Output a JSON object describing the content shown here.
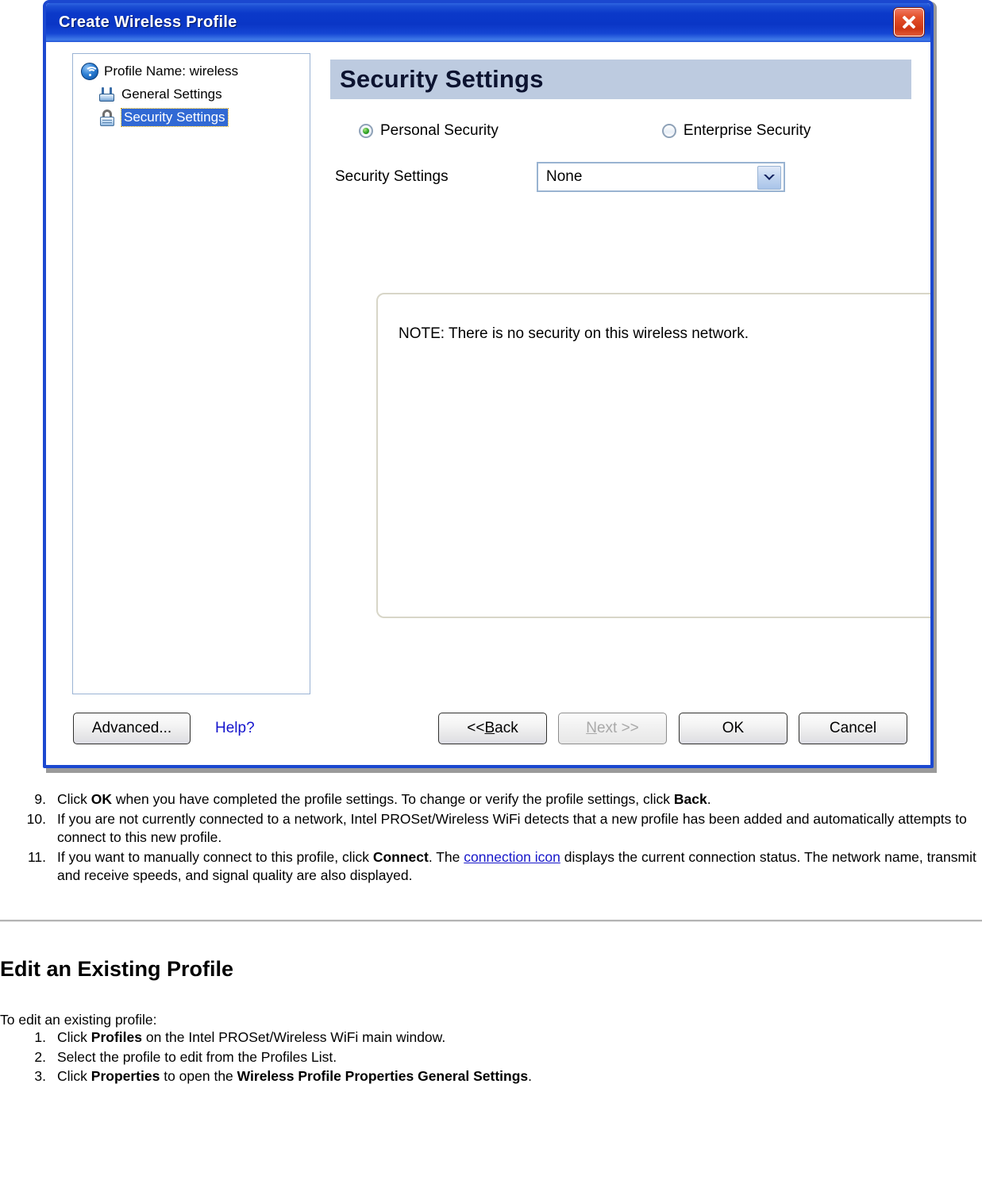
{
  "dialog": {
    "title": "Create Wireless Profile",
    "close_label": "Close",
    "tree": {
      "items": [
        {
          "label": "Profile Name: wireless",
          "icon": "wifi-icon",
          "selected": false,
          "level": 0
        },
        {
          "label": "General Settings",
          "icon": "access-point-icon",
          "selected": false,
          "level": 1
        },
        {
          "label": "Security Settings",
          "icon": "padlock-icon",
          "selected": true,
          "level": 1
        }
      ]
    },
    "pane": {
      "header": "Security Settings",
      "radios": [
        {
          "label": "Personal Security",
          "selected": true
        },
        {
          "label": "Enterprise Security",
          "selected": false
        }
      ],
      "security_settings_label": "Security Settings",
      "security_settings_value": "None",
      "security_settings_options": [
        "None"
      ],
      "note": "NOTE: There is no security on this wireless network."
    },
    "buttons": {
      "advanced": "Advanced...",
      "help": "Help?",
      "back": "<< Back",
      "back_prefix": "<< ",
      "back_accel": "B",
      "back_rest": "ack",
      "next": "Next >>",
      "next_accel": "N",
      "next_rest": "ext >>",
      "next_disabled": true,
      "ok": "OK",
      "cancel": "Cancel"
    },
    "colors": {
      "titlebar_blue": "#0a36c6",
      "header_band": "#bdcbe0",
      "selection_blue": "#3169d4",
      "link_blue": "#1414cd",
      "close_red": "#cf3612"
    }
  },
  "document": {
    "steps_continued": [
      {
        "num": "9.",
        "parts": [
          {
            "t": "Click ",
            "style": "normal"
          },
          {
            "t": "OK",
            "style": "bold"
          },
          {
            "t": " when you have completed the profile settings. To change or verify the profile settings, click ",
            "style": "normal"
          },
          {
            "t": "Back",
            "style": "bold"
          },
          {
            "t": ".",
            "style": "normal"
          }
        ]
      },
      {
        "num": "10.",
        "parts": [
          {
            "t": "If you are not currently connected to a network, Intel PROSet/Wireless WiFi detects that a new profile has been added and automatically attempts to connect to this new profile.",
            "style": "normal"
          }
        ]
      },
      {
        "num": "11.",
        "parts": [
          {
            "t": "If you want to manually connect to this profile, click ",
            "style": "normal"
          },
          {
            "t": "Connect",
            "style": "bold"
          },
          {
            "t": ". The ",
            "style": "normal"
          },
          {
            "t": "connection icon",
            "style": "link"
          },
          {
            "t": " displays the current connection status. The network name, transmit and receive speeds, and signal quality are also displayed.",
            "style": "normal"
          }
        ]
      }
    ],
    "section_heading": "Edit an Existing Profile",
    "lead_text": "To edit an existing profile:",
    "steps_edit": [
      {
        "num": "1.",
        "parts": [
          {
            "t": "Click ",
            "style": "normal"
          },
          {
            "t": "Profiles",
            "style": "bold"
          },
          {
            "t": " on the Intel PROSet/Wireless WiFi main window.",
            "style": "normal"
          }
        ]
      },
      {
        "num": "2.",
        "parts": [
          {
            "t": "Select the profile to edit from the Profiles List.",
            "style": "normal"
          }
        ]
      },
      {
        "num": "3.",
        "parts": [
          {
            "t": "Click ",
            "style": "normal"
          },
          {
            "t": "Properties",
            "style": "bold"
          },
          {
            "t": " to open the ",
            "style": "normal"
          },
          {
            "t": "Wireless Profile Properties General Settings",
            "style": "bold"
          },
          {
            "t": ".",
            "style": "normal"
          }
        ]
      }
    ]
  }
}
